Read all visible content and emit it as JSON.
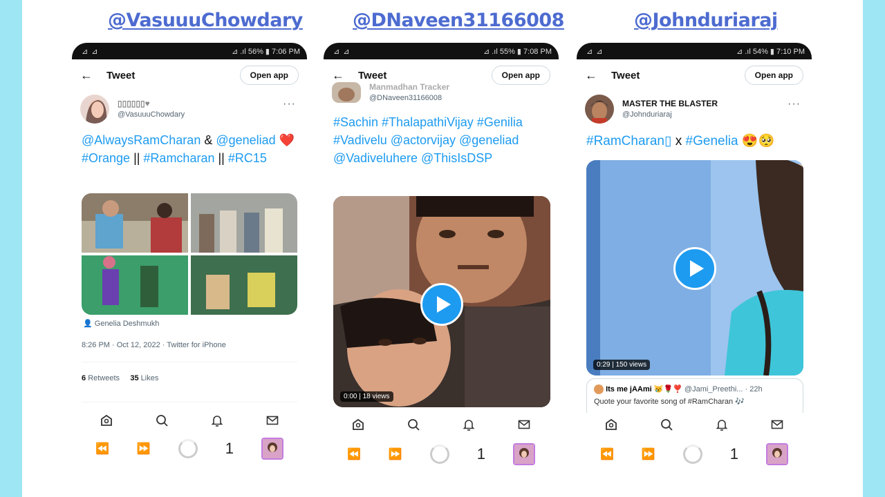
{
  "handles": [
    "@VasuuuChowdary",
    "@DNaveen31166008",
    "@Johnduriaraj"
  ],
  "phones": [
    {
      "status_left": "⊿ ⊿",
      "status_right": "⊿ .ıl 56% ▮ 7:06 PM",
      "header": {
        "title": "Tweet",
        "open_app": "Open app"
      },
      "author": {
        "name": "▯▯▯▯▯▯♥",
        "handle": "@VasuuuChowdary"
      },
      "text_segments": [
        {
          "t": "@AlwaysRamCharan",
          "link": true
        },
        {
          "t": " & ",
          "link": false
        },
        {
          "t": "@geneliad",
          "link": true
        },
        {
          "t": " ❤️ ",
          "link": false
        },
        {
          "t": "#Orange",
          "link": true
        },
        {
          "t": " || ",
          "link": false
        },
        {
          "t": "#Ramcharan",
          "link": true
        },
        {
          "t": " || ",
          "link": false
        },
        {
          "t": "#RC15",
          "link": true
        }
      ],
      "tagged": "Genelia Deshmukh",
      "timestamp": "8:26 PM · Oct 12, 2022 · Twitter for iPhone",
      "retweets_count": "6",
      "retweets_label": "Retweets",
      "likes_count": "35",
      "likes_label": "Likes",
      "bottom_num": "1"
    },
    {
      "status_left": "⊿ ⊿",
      "status_right": "⊿ .ıl 55% ▮ 7:08 PM",
      "header": {
        "title": "Tweet",
        "open_app": "Open app"
      },
      "author": {
        "name": "Manmadhan Tracker",
        "handle": "@DNaveen31166008"
      },
      "text_segments": [
        {
          "t": "#Sachin #ThalapathiVijay #Genilia #Vadivelu @actorvijay @geneliad @Vadiveluhere @ThisIsDSP",
          "link": true
        }
      ],
      "video_meta": "0:00 | 18 views",
      "bottom_num": "1"
    },
    {
      "status_left": "⊿ ⊿",
      "status_right": "⊿ .ıl 54% ▮ 7:10 PM",
      "header": {
        "title": "Tweet",
        "open_app": "Open app"
      },
      "author": {
        "name": "MASTER THE BLASTER",
        "handle": "@Johnduriaraj"
      },
      "text_segments": [
        {
          "t": "#RamCharan▯",
          "link": true
        },
        {
          "t": " x ",
          "link": false
        },
        {
          "t": "#Genelia",
          "link": true
        },
        {
          "t": "  😍🥺",
          "link": false
        }
      ],
      "video_meta": "0:29 | 150 views",
      "quote": {
        "name": "Its me jAAmi 😿🌹❣️",
        "handle": "@Jami_Preethi...",
        "time": "· 22h",
        "text": "Quote your favorite song of #RamCharan 🎶"
      },
      "bottom_num": "1"
    }
  ],
  "colors": {
    "link": "#1d9bf0",
    "handle": "#4d6bd0",
    "bg": "#9ee6f4"
  }
}
